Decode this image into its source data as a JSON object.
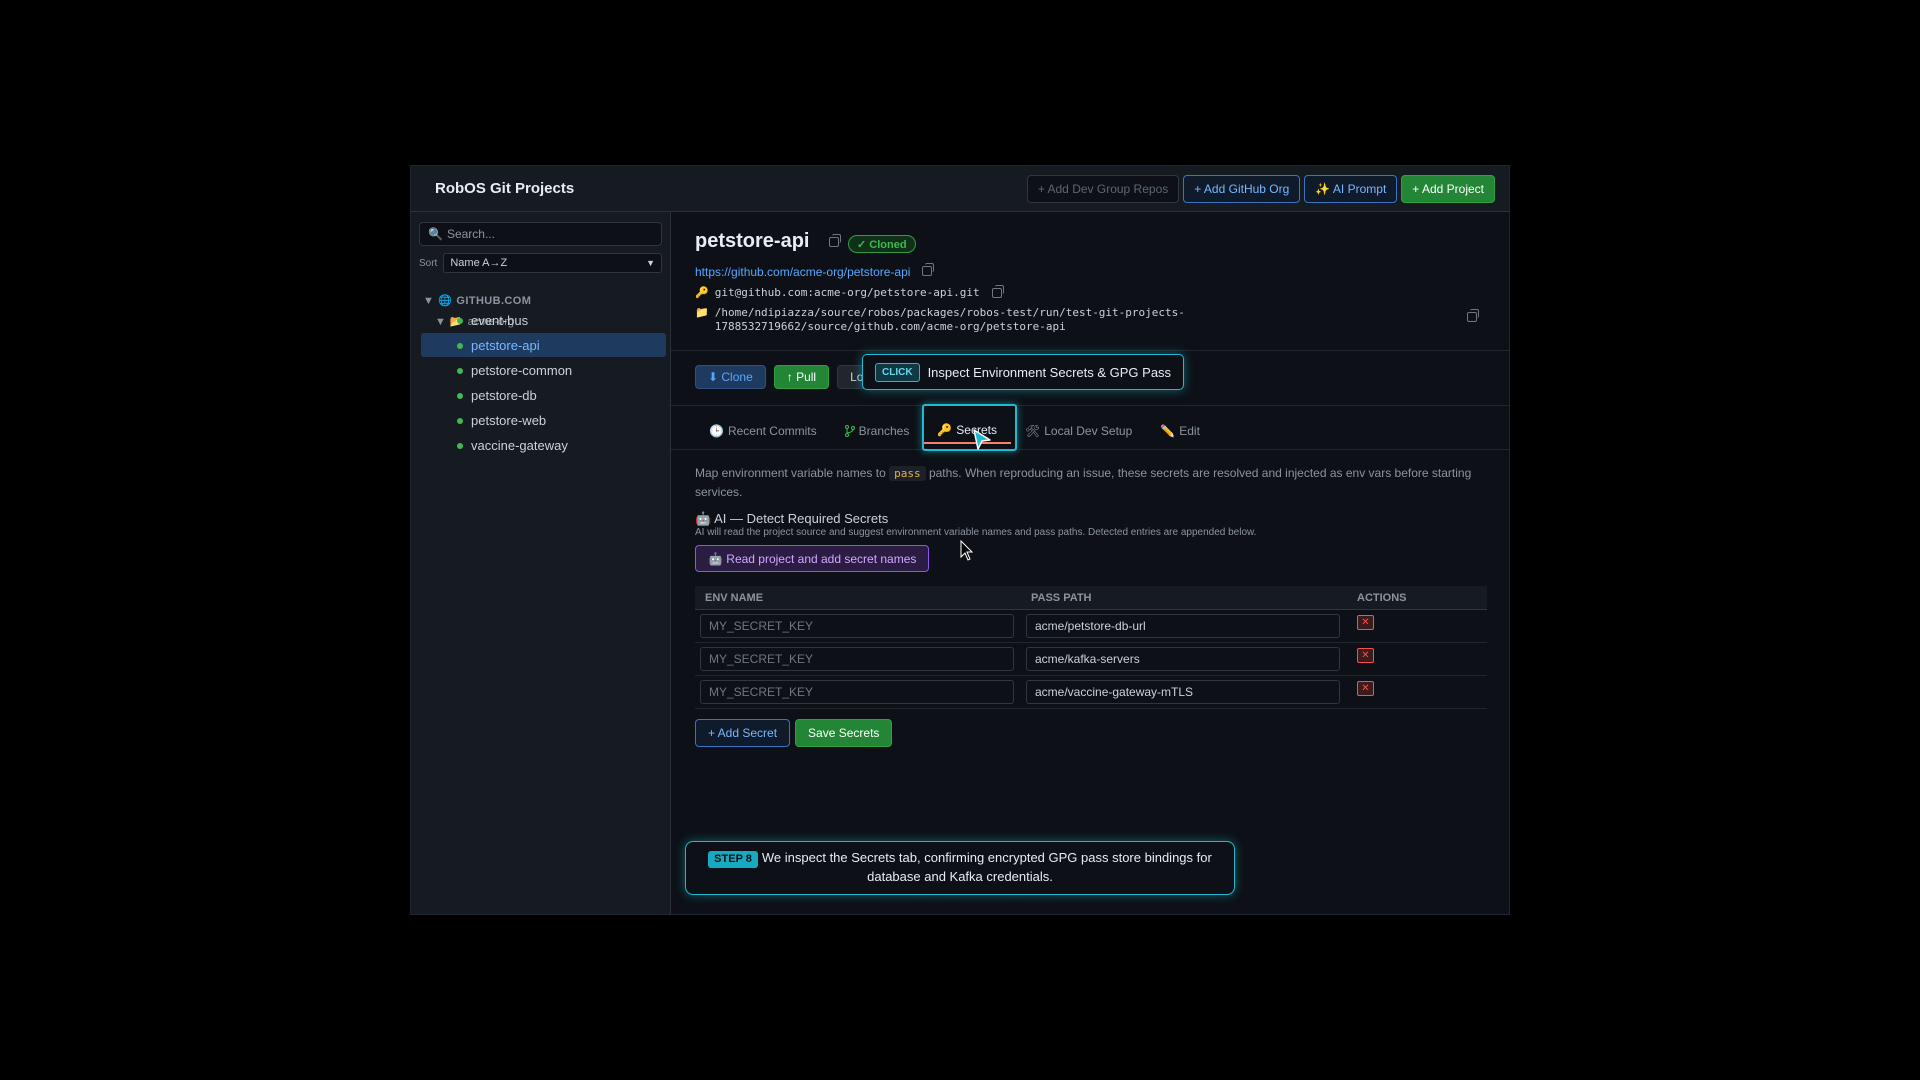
{
  "app": {
    "title": "RobOS Git Projects",
    "actions": {
      "add_dev_group": "+ Add Dev Group Repos",
      "add_github_org": "+ Add GitHub Org",
      "ai_prompt": "✨ AI Prompt",
      "add_project": "+ Add Project"
    }
  },
  "sidebar": {
    "search_placeholder": "Search...",
    "sort_label": "Sort",
    "sort_value": "Name A→Z",
    "host": "GITHUB.COM",
    "org": "acme-org",
    "repos": [
      "event-bus",
      "petstore-api",
      "petstore-common",
      "petstore-db",
      "petstore-web",
      "vaccine-gateway"
    ],
    "active_repo": "petstore-api"
  },
  "project": {
    "name": "petstore-api",
    "status": "✓ Cloned",
    "url": "https://github.com/acme-org/petstore-api",
    "ssh": "git@github.com:acme-org/petstore-api.git",
    "path_line1": "/home/ndipiazza/source/robos/packages/robos-test/run/test-git-projects-",
    "path_line2": "1788532719662/source/github.com/acme-org/petstore-api"
  },
  "buttons": {
    "clone": "⬇ Clone",
    "pull": "↑ Pull",
    "lo": "Lo"
  },
  "tabs": [
    {
      "icon": "🕒",
      "label": "Recent Commits"
    },
    {
      "icon": "",
      "label": "Branches"
    },
    {
      "icon": "🔑",
      "label": "Secrets"
    },
    {
      "icon": "🛠",
      "label": "Local Dev Setup"
    },
    {
      "icon": "✏️",
      "label": "Edit"
    }
  ],
  "secrets": {
    "desc_before": "Map environment variable names to ",
    "desc_code": "pass",
    "desc_after": " paths. When reproducing an issue, these secrets are resolved and injected as env vars before starting services.",
    "ai_title": "🤖 AI — Detect Required Secrets",
    "ai_sub": "AI will read the project source and suggest environment variable names and pass paths. Detected entries are appended below.",
    "ai_button": "🤖 Read project and add secret names",
    "headers": {
      "env": "ENV NAME",
      "pass": "PASS PATH",
      "actions": "ACTIONS"
    },
    "env_placeholder": "MY_SECRET_KEY",
    "rows": [
      {
        "pass_path": "acme/petstore-db-url"
      },
      {
        "pass_path": "acme/kafka-servers"
      },
      {
        "pass_path": "acme/vaccine-gateway-mTLS"
      }
    ],
    "delete_glyph": "✕",
    "add_secret": "+ Add Secret",
    "save_secrets": "Save Secrets"
  },
  "overlay": {
    "click_tag": "CLICK",
    "click_text": "Inspect Environment Secrets & GPG Pass",
    "step_tag": "STEP 8",
    "step_text": "We inspect the Secrets tab, confirming encrypted GPG pass store bindings for database and Kafka credentials."
  }
}
